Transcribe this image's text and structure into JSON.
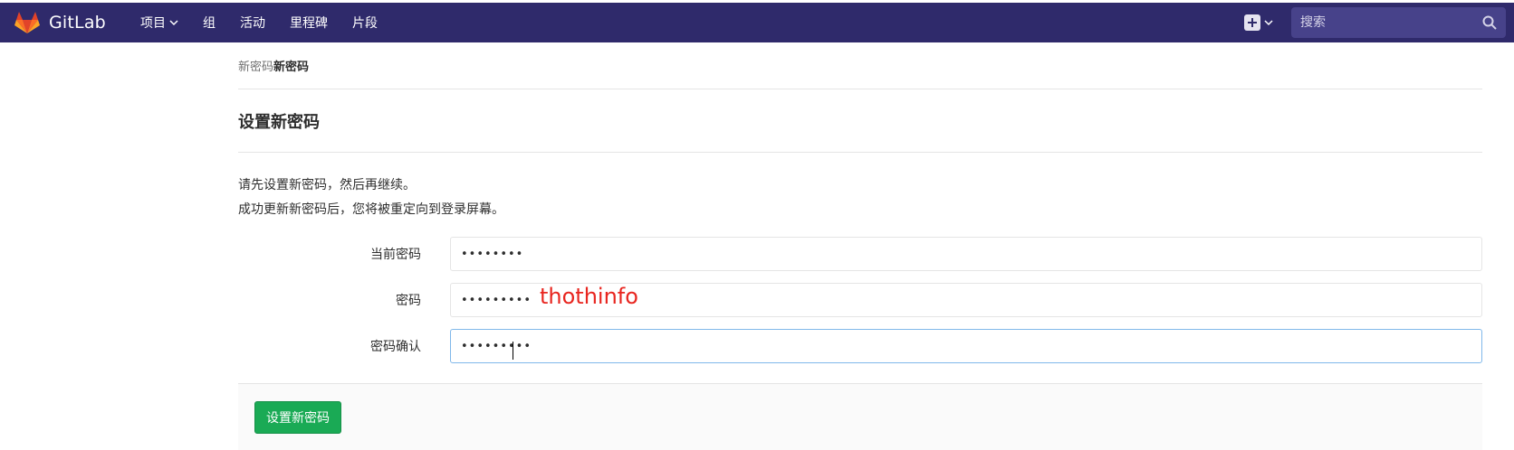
{
  "navbar": {
    "brand_name": "GitLab",
    "links": [
      {
        "label": "项目",
        "has_dropdown": true
      },
      {
        "label": "组",
        "has_dropdown": false
      },
      {
        "label": "活动",
        "has_dropdown": false
      },
      {
        "label": "里程碑",
        "has_dropdown": false
      },
      {
        "label": "片段",
        "has_dropdown": false
      }
    ],
    "new_icon": "plus-square-icon",
    "search_placeholder": "搜索",
    "search_icon": "search-icon",
    "colors": {
      "background": "#2f2a6b",
      "search_background": "#47428a",
      "logo_orange": "#fc6d26"
    }
  },
  "breadcrumb": {
    "link": "新密码",
    "current": "新密码"
  },
  "page": {
    "title": "设置新密码",
    "description_line1": "请先设置新密码，然后再继续。",
    "description_line2": "成功更新新密码后，您将被重定向到登录屏幕。"
  },
  "form": {
    "current_password_label": "当前密码",
    "current_password_value": "••••••••",
    "password_label": "密码",
    "password_value": "•••••••••",
    "confirm_label": "密码确认",
    "confirm_value": "•••••••••",
    "submit_label": "设置新密码",
    "colors": {
      "submit": "#1aaa55",
      "focus_border": "#80b8ea"
    }
  },
  "watermark": "thothinfo"
}
